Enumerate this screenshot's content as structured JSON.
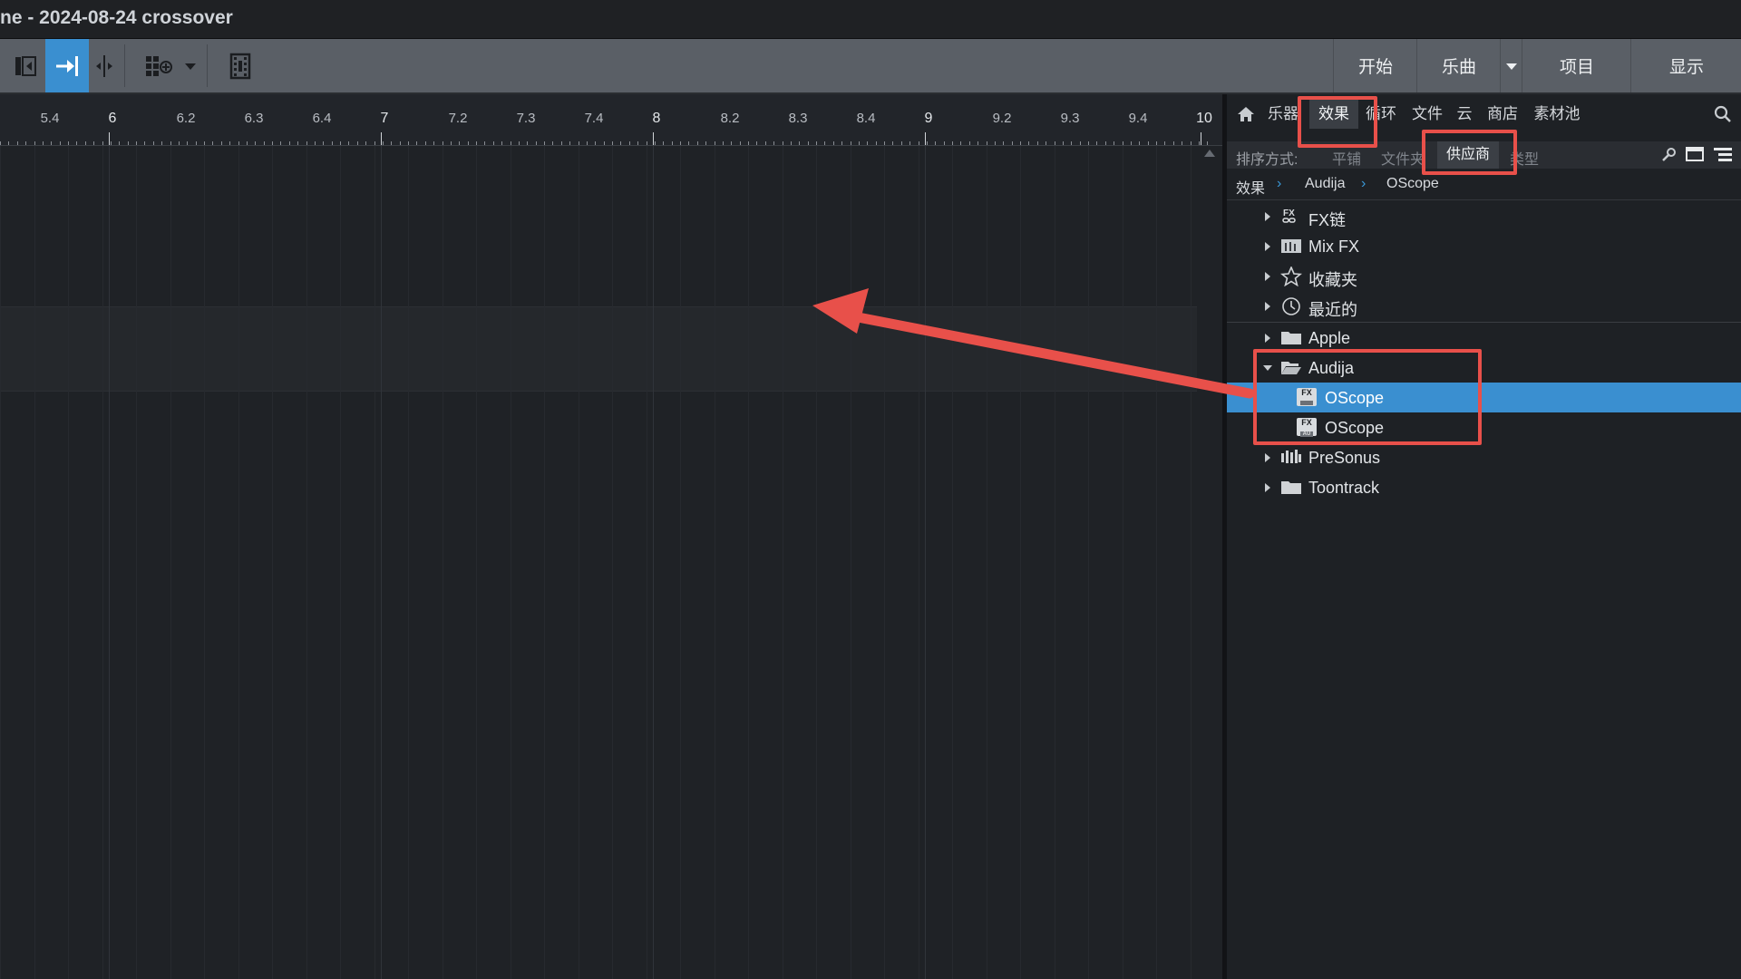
{
  "window": {
    "title": "ne - 2024-08-24 crossover"
  },
  "toolbar": {
    "right_buttons": [
      "开始",
      "乐曲",
      "项目",
      "显示"
    ]
  },
  "ruler": {
    "labels": [
      "5.4",
      "6",
      "6.2",
      "6.3",
      "6.4",
      "7",
      "7.2",
      "7.3",
      "7.4",
      "8",
      "8.2",
      "8.3",
      "8.4",
      "9",
      "9.2",
      "9.3",
      "9.4",
      "10"
    ]
  },
  "browser": {
    "tabs": [
      "乐器",
      "效果",
      "循环",
      "文件",
      "云",
      "商店",
      "素材池"
    ],
    "active_tab": "效果",
    "sort": {
      "label": "排序方式:",
      "options": [
        "平铺",
        "文件夹",
        "供应商",
        "类型"
      ],
      "active": "供应商"
    },
    "breadcrumb": [
      "效果",
      "Audija",
      "OScope"
    ],
    "tree": [
      {
        "label": "FX链",
        "icon": "fx-chain-icon"
      },
      {
        "label": "Mix FX",
        "icon": "mix-fx-icon"
      },
      {
        "label": "收藏夹",
        "icon": "star-icon"
      },
      {
        "label": "最近的",
        "icon": "clock-icon"
      },
      {
        "label": "Apple",
        "icon": "folder-icon"
      },
      {
        "label": "Audija",
        "icon": "folder-open-icon",
        "expanded": true
      },
      {
        "label": "OScope",
        "icon": "fx-plugin-icon",
        "tag": "FX",
        "selected": true
      },
      {
        "label": "OScope",
        "icon": "fx-au-plugin-icon",
        "tag": "FX",
        "subtag": "AU"
      },
      {
        "label": "PreSonus",
        "icon": "presonus-icon"
      },
      {
        "label": "Toontrack",
        "icon": "folder-icon"
      }
    ]
  },
  "colors": {
    "accent": "#3a8fd0",
    "annotation": "#e8504a",
    "toolbar": "#5a5f66",
    "background": "#1d2024"
  }
}
